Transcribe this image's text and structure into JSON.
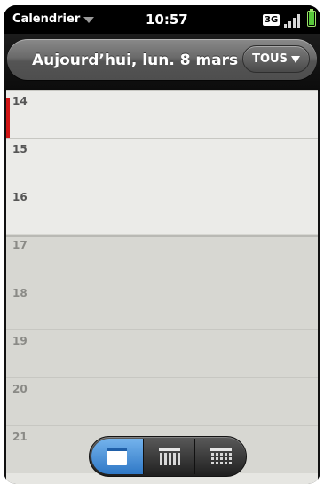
{
  "status_bar": {
    "app_menu_label": "Calendrier",
    "time": "10:57",
    "network": "3G"
  },
  "header": {
    "date_title": "Aujourd’hui, lun. 8 mars",
    "filter_label": "TOUS"
  },
  "day_grid": {
    "hours": [
      {
        "label": "14",
        "work": true
      },
      {
        "label": "15",
        "work": true
      },
      {
        "label": "16",
        "work": true
      },
      {
        "label": "17",
        "work": false
      },
      {
        "label": "18",
        "work": false
      },
      {
        "label": "19",
        "work": false
      },
      {
        "label": "20",
        "work": false
      },
      {
        "label": "21",
        "work": false
      }
    ]
  },
  "view_switcher": {
    "selected": "day",
    "views": [
      "day",
      "week",
      "month"
    ]
  },
  "icons": {
    "app_menu": "chevron-down-icon",
    "filter": "triangle-down-icon",
    "signal": "signal-bars-icon",
    "battery": "battery-icon",
    "day_view": "day-view-icon",
    "week_view": "week-view-icon",
    "month_view": "month-view-icon"
  },
  "colors": {
    "now_marker": "#d01515",
    "selected_segment": "#3f88d6",
    "battery": "#58c93a"
  }
}
